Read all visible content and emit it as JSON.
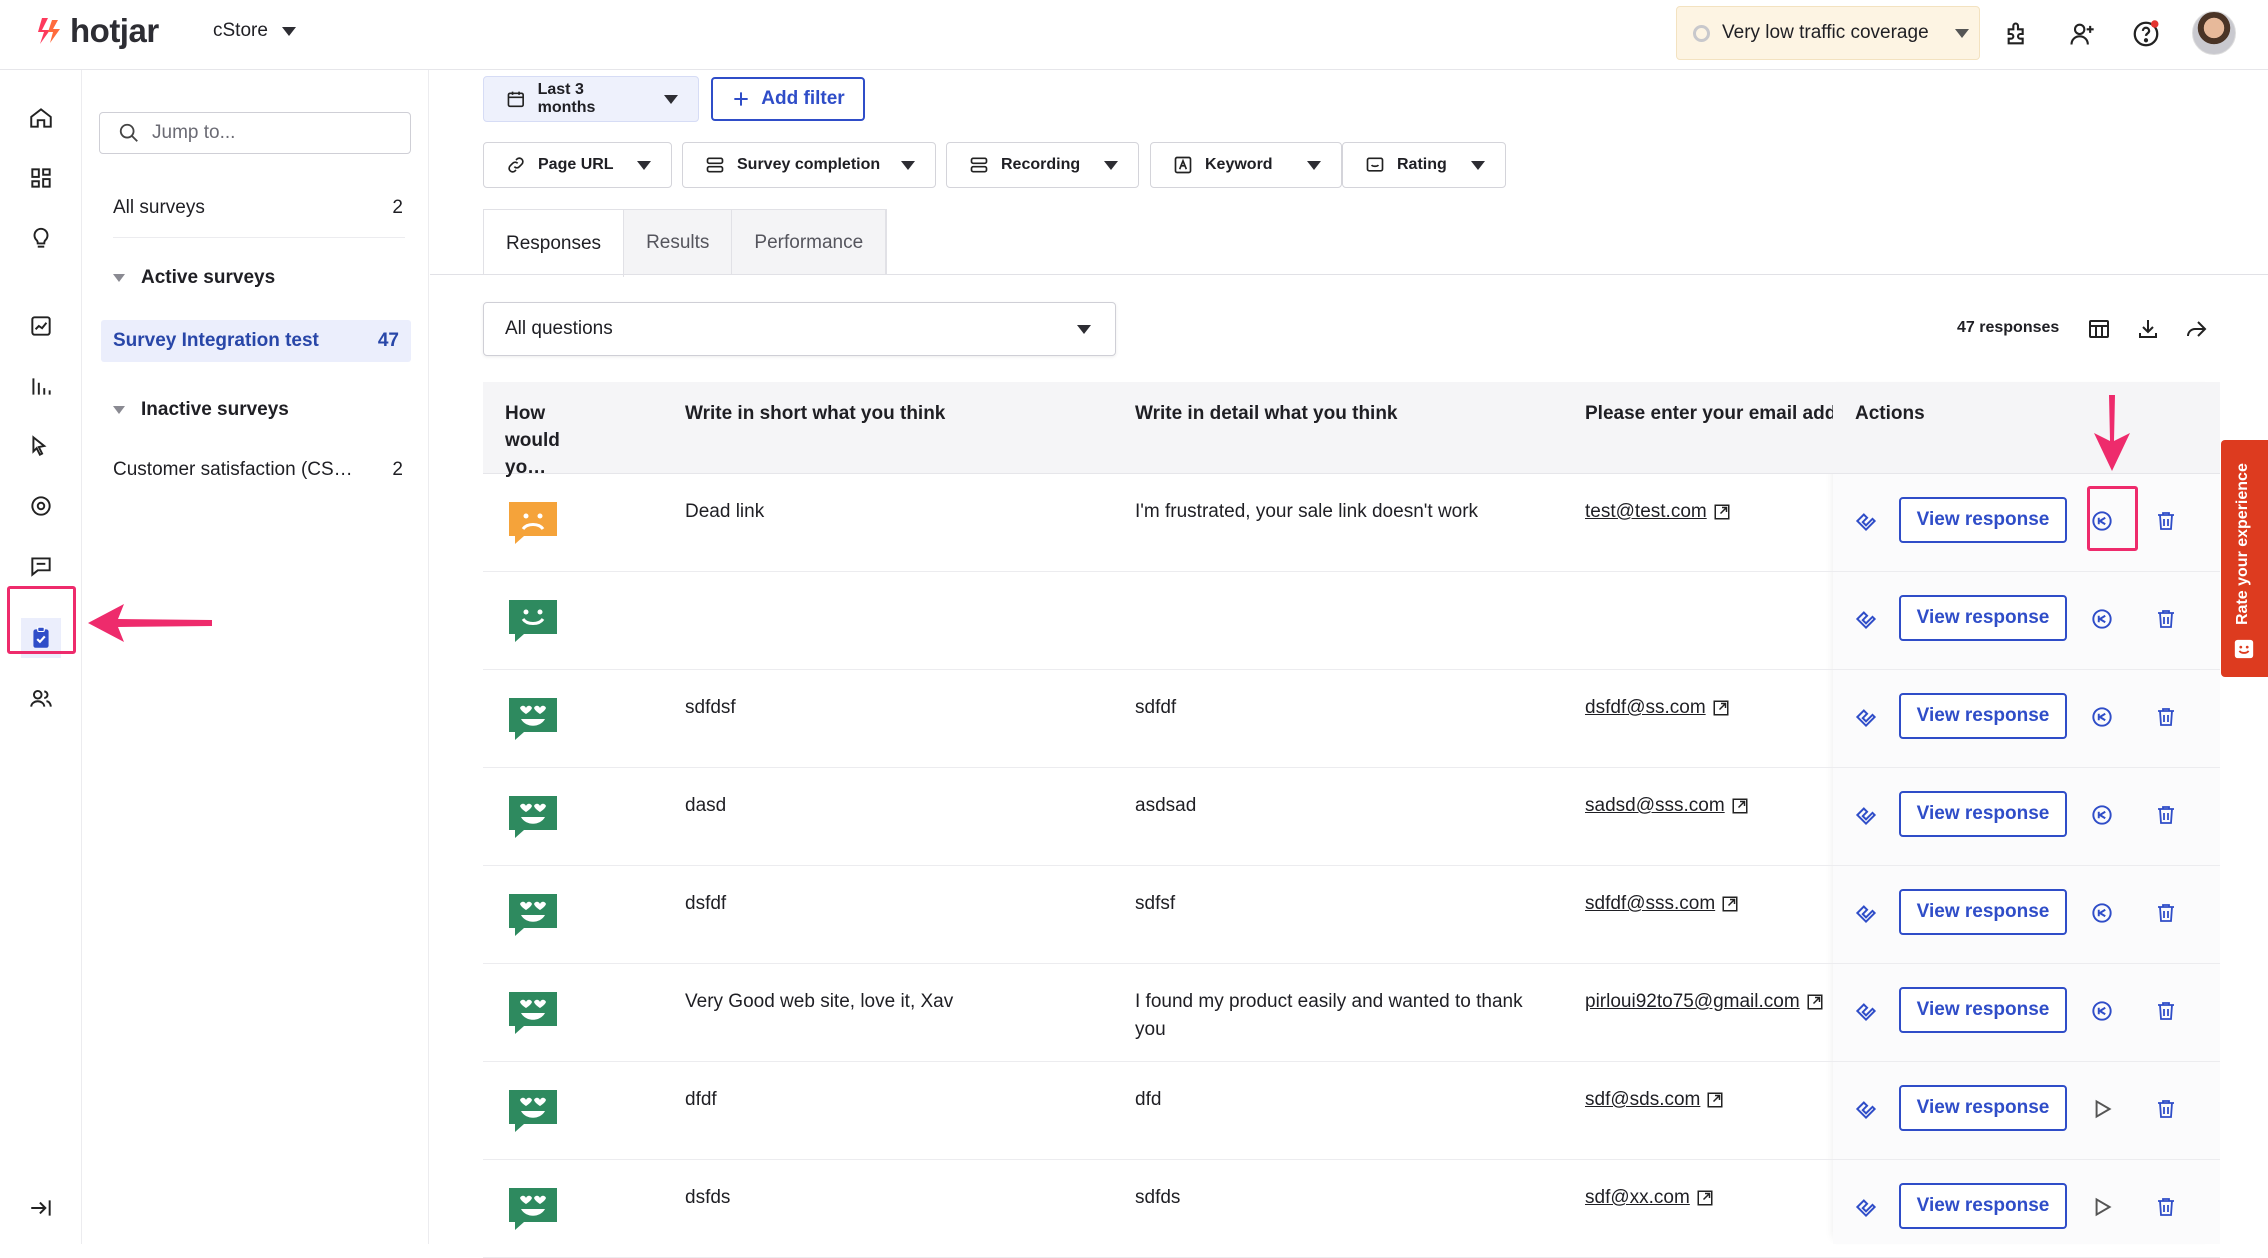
{
  "topbar": {
    "logo_text": "hotjar",
    "site_name": "cStore",
    "traffic_label": "Very low traffic coverage"
  },
  "sidebar": {
    "jump_placeholder": "Jump to...",
    "all_surveys": {
      "label": "All surveys",
      "count": "2"
    },
    "active_group": "Active surveys",
    "active_item": {
      "label": "Survey Integration test",
      "count": "47"
    },
    "inactive_group": "Inactive surveys",
    "inactive_item": {
      "label": "Customer satisfaction (CS…",
      "count": "2"
    }
  },
  "filters": {
    "date": "Last 3 months",
    "add_filter": "Add filter",
    "page_url": "Page URL",
    "survey_completion": "Survey completion",
    "recording": "Recording",
    "keyword": "Keyword",
    "rating": "Rating"
  },
  "tabs": [
    "Responses",
    "Results",
    "Performance"
  ],
  "question_select": "All questions",
  "response_count": "47 responses",
  "table": {
    "headers": [
      "How would yo…",
      "Write in short what you think",
      "Write in detail what you think",
      "Please enter your email address",
      "Actions"
    ],
    "view_label": "View response",
    "rows": [
      {
        "face": "sad",
        "short": "Dead link",
        "detail": "I'm frustrated, your sale link doesn't work",
        "email": "test@test.com",
        "action": "rewatch"
      },
      {
        "face": "happy",
        "short": "",
        "detail": "",
        "email": "",
        "action": "rewatch"
      },
      {
        "face": "love",
        "short": "sdfdsf",
        "detail": "sdfdf",
        "email": "dsfdf@ss.com",
        "action": "rewatch"
      },
      {
        "face": "love",
        "short": "dasd",
        "detail": "asdsad",
        "email": "sadsd@sss.com",
        "action": "rewatch"
      },
      {
        "face": "love",
        "short": "dsfdf",
        "detail": "sdfsf",
        "email": "sdfdf@sss.com",
        "action": "rewatch"
      },
      {
        "face": "love",
        "short": "Very Good web site, love it, Xav",
        "detail": "I found my product easily and wanted to thank you",
        "email": "pirloui92to75@gmail.com",
        "action": "rewatch"
      },
      {
        "face": "love",
        "short": "dfdf",
        "detail": "dfd",
        "email": "sdf@sds.com",
        "action": "play"
      },
      {
        "face": "love",
        "short": "dsfds",
        "detail": "sdfds",
        "email": "sdf@xx.com",
        "action": "play"
      }
    ]
  },
  "feedback_tab": "Rate your experience",
  "colors": {
    "accent": "#2f4dc8",
    "highlight": "#ee2b6c",
    "face_sad": "#f5a33a",
    "face_happy": "#2e8a5f",
    "feedback": "#dd3b1f"
  }
}
